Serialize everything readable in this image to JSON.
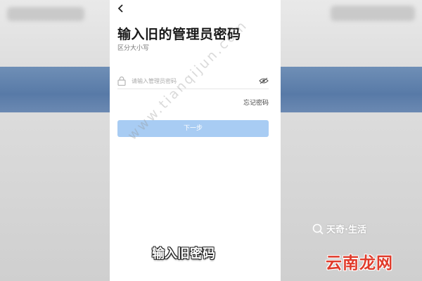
{
  "screen": {
    "title": "输入旧的管理员密码",
    "subtitle": "区分大小写",
    "password_placeholder": "请输入管理员密码",
    "forgot_password": "忘记密码",
    "next_button": "下一步",
    "back_icon": "chevron-left-icon",
    "lock_icon": "lock-icon",
    "visibility_icon": "eye-off-icon"
  },
  "overlay": {
    "watermark": "www.tianqijun.com",
    "caption": "输入旧密码",
    "logo_text": "天奇·生活",
    "site_text": "云南龙网"
  },
  "colors": {
    "button_bg": "#a8ccf3",
    "site_text": "#e03b2b",
    "band": "#587aa7"
  }
}
